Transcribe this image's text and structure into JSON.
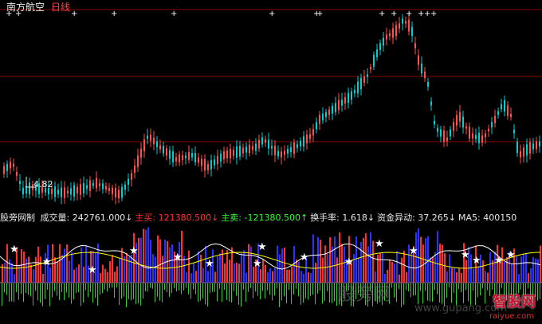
{
  "header": {
    "stock_name": "南方航空",
    "period": "日线"
  },
  "price_panel": {
    "low_label": "4.82"
  },
  "indicator": {
    "name": "股旁网制",
    "fields": [
      {
        "label": "成交量:",
        "value": "242761.000",
        "arrow": "↓",
        "color": "#e8e8e8"
      },
      {
        "label": "主买:",
        "value": "121380.500",
        "arrow": "↓",
        "color": "#ff3333"
      },
      {
        "label": "主卖:",
        "value": "-121380.500",
        "arrow": "↑",
        "color": "#33ff33"
      },
      {
        "label": "换手率:",
        "value": "1.618",
        "arrow": "↓",
        "color": "#e8e8e8"
      },
      {
        "label": "资金异动:",
        "value": "37.265",
        "arrow": "↓",
        "color": "#e8e8e8"
      },
      {
        "label": "MA5:",
        "value": "400150",
        "arrow": "",
        "color": "#e8e8e8"
      }
    ]
  },
  "watermark": {
    "text": "股旁网",
    "url": "www.gupang.com"
  },
  "logo": {
    "name": "智股网",
    "url": "raiyue.com"
  },
  "colors": {
    "up": "#ff5050",
    "down": "#00d0d0",
    "ma": "#ffffff",
    "grid": "#8b0000",
    "volume_up": "#ff3030",
    "volume_down": "#3030ff"
  }
}
